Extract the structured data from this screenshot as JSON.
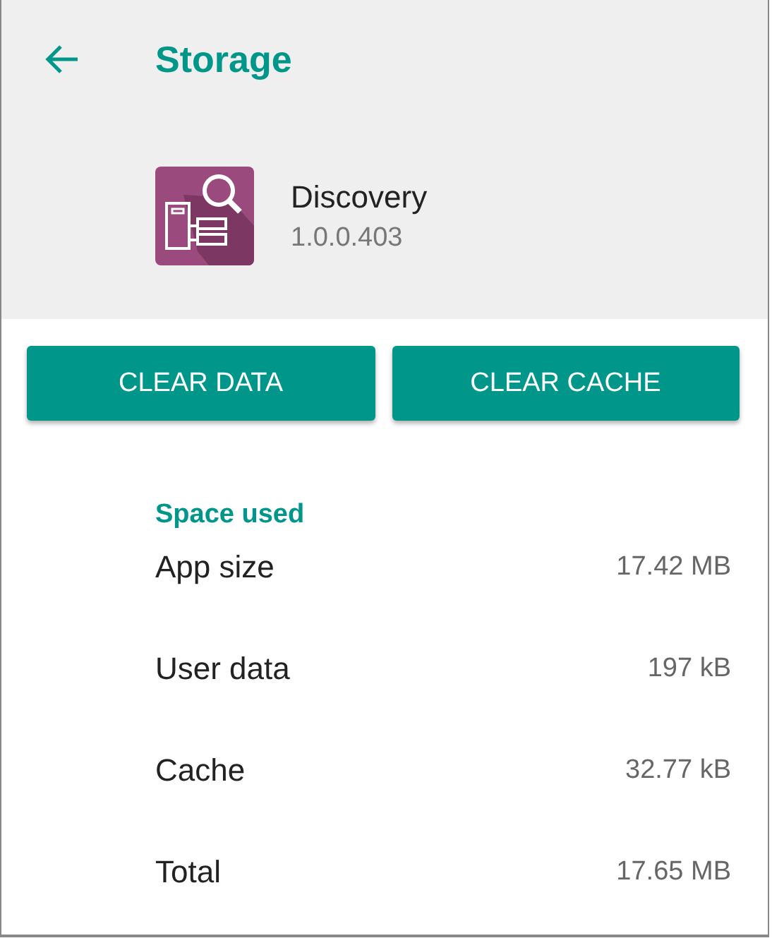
{
  "toolbar": {
    "title": "Storage"
  },
  "app": {
    "name": "Discovery",
    "version": "1.0.0.403"
  },
  "buttons": [
    "CLEAR DATA",
    "CLEAR CACHE"
  ],
  "section": {
    "title": "Space used",
    "rows": [
      {
        "label": "App size",
        "value": "17.42 MB"
      },
      {
        "label": "User data",
        "value": "197 kB"
      },
      {
        "label": "Cache",
        "value": "32.77 kB"
      },
      {
        "label": "Total",
        "value": "17.65 MB"
      }
    ]
  }
}
